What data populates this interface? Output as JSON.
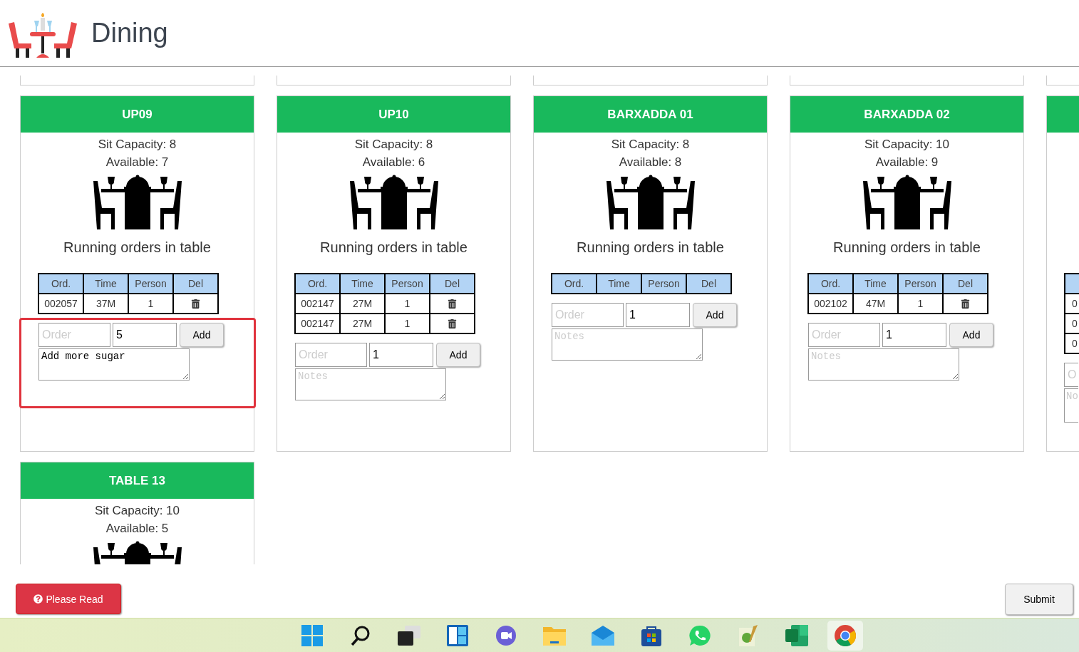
{
  "app": {
    "title": "Dining"
  },
  "cards": [
    {
      "kind": "full",
      "title": "UP09",
      "capacity": "Sit Capacity: 8",
      "available": "Available: 7",
      "heading": "Running orders in table",
      "columns": [
        "Ord.",
        "Time",
        "Person",
        "Del"
      ],
      "rows": [
        {
          "ord": "002057",
          "time": "37M",
          "person": "1"
        }
      ],
      "order_placeholder": "Order",
      "qty": "5",
      "notes": "Add more sugar",
      "add": "Add",
      "highlighted": true
    },
    {
      "kind": "full",
      "title": "UP10",
      "capacity": "Sit Capacity: 8",
      "available": "Available: 6",
      "heading": "Running orders in table",
      "columns": [
        "Ord.",
        "Time",
        "Person",
        "Del"
      ],
      "rows": [
        {
          "ord": "002147",
          "time": "27M",
          "person": "1"
        },
        {
          "ord": "002147",
          "time": "27M",
          "person": "1"
        }
      ],
      "order_placeholder": "Order",
      "qty": "1",
      "notes_placeholder": "Notes",
      "add": "Add",
      "highlighted": false
    },
    {
      "kind": "full",
      "title": "BARXADDA 01",
      "capacity": "Sit Capacity: 8",
      "available": "Available: 8",
      "heading": "Running orders in table",
      "columns": [
        "Ord.",
        "Time",
        "Person",
        "Del"
      ],
      "order_placeholder": "Order",
      "qty": "1",
      "notes_placeholder": "Notes",
      "add": "Add",
      "highlighted": false
    },
    {
      "kind": "full",
      "title": "BARXADDA 02",
      "capacity": "Sit Capacity: 10",
      "available": "Available: 9",
      "heading": "Running orders in table",
      "columns": [
        "Ord.",
        "Time",
        "Person",
        "Del"
      ],
      "rows": [
        {
          "ord": "002102",
          "time": "47M",
          "person": "1"
        }
      ],
      "order_placeholder": "Order",
      "qty": "1",
      "notes_placeholder": "Notes",
      "add": "Add",
      "highlighted": false
    },
    {
      "kind": "partial",
      "rows": [
        {
          "ord": "0"
        },
        {
          "ord": "0"
        },
        {
          "ord": "0"
        }
      ],
      "order_placeholder": "O",
      "notes_placeholder": "No"
    },
    {
      "kind": "full",
      "title": "TABLE 13",
      "capacity": "Sit Capacity: 10",
      "available": "Available: 5"
    }
  ],
  "footer": {
    "help_button": "Please Read",
    "submit_button": "Submit"
  },
  "taskbar": {
    "apps": [
      {
        "kind": "start"
      },
      {
        "kind": "search"
      },
      {
        "kind": "taskview"
      },
      {
        "kind": "widgets"
      },
      {
        "kind": "video"
      },
      {
        "kind": "folder"
      },
      {
        "kind": "mail"
      },
      {
        "kind": "store"
      },
      {
        "kind": "phone"
      },
      {
        "kind": "notepad"
      },
      {
        "kind": "sheet"
      },
      {
        "kind": "browser",
        "selected": true
      }
    ]
  }
}
